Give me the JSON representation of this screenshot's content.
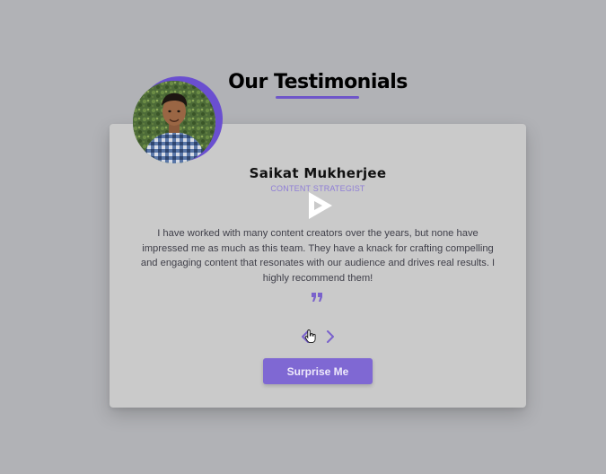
{
  "header": {
    "title": "Our Testimonials"
  },
  "testimonial": {
    "avatar_icon": "user-photo",
    "name": "Saikat Mukherjee",
    "role": "CONTENT STRATEGIST",
    "text": "I have worked with many content creators over the years, but none have impressed me as much as this team. They have a knack for crafting compelling and engaging content that resonates with our audience and drives real results. I highly recommend them!"
  },
  "icons": {
    "play": "play-icon",
    "quote": "quote-icon",
    "prev": "chevron-left-icon",
    "next": "chevron-right-icon",
    "cursor": "hand-pointer-icon"
  },
  "actions": {
    "surprise_label": "Surprise Me"
  },
  "colors": {
    "background": "#b1b2b6",
    "card": "#cacaca",
    "accent": "#6f56c9",
    "button": "#7f68d3"
  }
}
